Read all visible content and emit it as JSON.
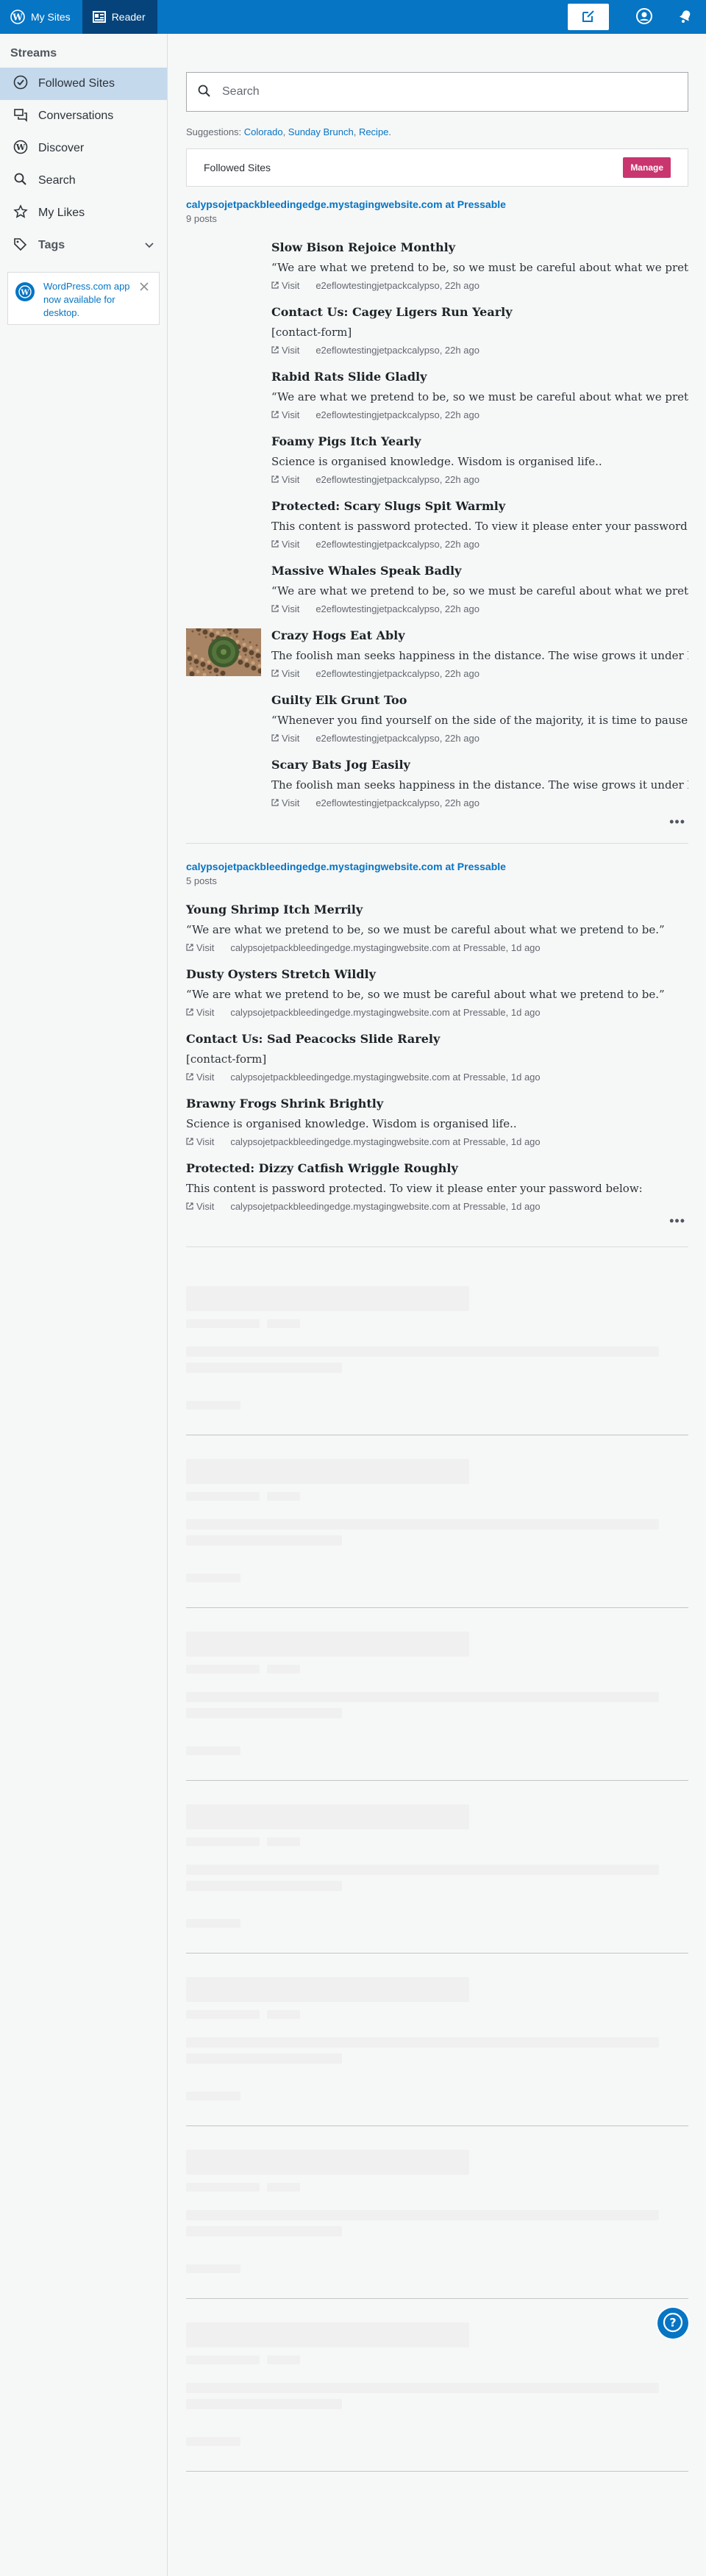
{
  "masterbar": {
    "my_sites": "My Sites",
    "reader": "Reader",
    "write_icon": "write-icon",
    "profile_icon": "profile-icon",
    "notifications_icon": "bell-icon"
  },
  "sidebar": {
    "heading": "Streams",
    "items": [
      {
        "label": "Followed Sites",
        "icon": "check-circle-icon"
      },
      {
        "label": "Conversations",
        "icon": "chat-icon"
      },
      {
        "label": "Discover",
        "icon": "wordpress-icon"
      },
      {
        "label": "Search",
        "icon": "search-icon"
      },
      {
        "label": "My Likes",
        "icon": "star-icon"
      },
      {
        "label": "Tags",
        "icon": "tag-icon"
      }
    ],
    "notice": "WordPress.com app now available for desktop."
  },
  "search": {
    "placeholder": "Search"
  },
  "suggestions": {
    "label": "Suggestions:",
    "items": [
      "Colorado",
      "Sunday Brunch",
      "Recipe"
    ]
  },
  "followed_card": {
    "title": "Followed Sites",
    "button": "Manage"
  },
  "groups": [
    {
      "site": "calypsojetpackbleedingedge.mystagingwebsite.com at Pressable",
      "count": "9 posts",
      "posts": [
        {
          "title": "Slow Bison Rejoice Monthly",
          "excerpt": "“We are what we pretend to be, so we must be careful about what we pretend to be.”",
          "visit": "Visit",
          "meta": "e2eflowtestingjetpackcalypso, 22h ago"
        },
        {
          "title": "Contact Us: Cagey Ligers Run Yearly",
          "excerpt": "[contact-form]",
          "visit": "Visit",
          "meta": "e2eflowtestingjetpackcalypso, 22h ago"
        },
        {
          "title": "Rabid Rats Slide Gladly",
          "excerpt": "“We are what we pretend to be, so we must be careful about what we pretend to be.”",
          "visit": "Visit",
          "meta": "e2eflowtestingjetpackcalypso, 22h ago"
        },
        {
          "title": "Foamy Pigs Itch Yearly",
          "excerpt": "Science is organised knowledge. Wisdom is organised life..",
          "visit": "Visit",
          "meta": "e2eflowtestingjetpackcalypso, 22h ago"
        },
        {
          "title": "Protected: Scary Slugs Spit Warmly",
          "excerpt": "This content is password protected. To view it please enter your password below:",
          "visit": "Visit",
          "meta": "e2eflowtestingjetpackcalypso, 22h ago"
        },
        {
          "title": "Massive Whales Speak Badly",
          "excerpt": "“We are what we pretend to be, so we must be careful about what we pretend to be.”",
          "visit": "Visit",
          "meta": "e2eflowtestingjetpackcalypso, 22h ago"
        },
        {
          "title": "Crazy Hogs Eat Ably",
          "excerpt": "The foolish man seeks happiness in the distance. The wise grows it under his feet.",
          "visit": "Visit",
          "meta": "e2eflowtestingjetpackcalypso, 22h ago",
          "thumb": true
        },
        {
          "title": "Guilty Elk Grunt Too",
          "excerpt": "“Whenever you find yourself on the side of the majority, it is time to pause and reflect.”",
          "visit": "Visit",
          "meta": "e2eflowtestingjetpackcalypso, 22h ago"
        },
        {
          "title": "Scary Bats Jog Easily",
          "excerpt": "The foolish man seeks happiness in the distance. The wise grows it under his feet.",
          "visit": "Visit",
          "meta": "e2eflowtestingjetpackcalypso, 22h ago"
        }
      ]
    },
    {
      "site": "calypsojetpackbleedingedge.mystagingwebsite.com at Pressable",
      "count": "5 posts",
      "posts": [
        {
          "title": "Young Shrimp Itch Merrily",
          "excerpt": "“We are what we pretend to be, so we must be careful about what we pretend to be.”",
          "visit": "Visit",
          "meta": "calypsojetpackbleedingedge.mystagingwebsite.com at Pressable, 1d ago"
        },
        {
          "title": "Dusty Oysters Stretch Wildly",
          "excerpt": "“We are what we pretend to be, so we must be careful about what we pretend to be.”",
          "visit": "Visit",
          "meta": "calypsojetpackbleedingedge.mystagingwebsite.com at Pressable, 1d ago"
        },
        {
          "title": "Contact Us: Sad Peacocks Slide Rarely",
          "excerpt": "[contact-form]",
          "visit": "Visit",
          "meta": "calypsojetpackbleedingedge.mystagingwebsite.com at Pressable, 1d ago"
        },
        {
          "title": "Brawny Frogs Shrink Brightly",
          "excerpt": "Science is organised knowledge. Wisdom is organised life..",
          "visit": "Visit",
          "meta": "calypsojetpackbleedingedge.mystagingwebsite.com at Pressable, 1d ago"
        },
        {
          "title": "Protected: Dizzy Catfish Wriggle Roughly",
          "excerpt": "This content is password protected. To view it please enter your password below:",
          "visit": "Visit",
          "meta": "calypsojetpackbleedingedge.mystagingwebsite.com at Pressable, 1d ago"
        }
      ]
    }
  ],
  "more_icon": "ellipsis-icon",
  "help_icon": "help-icon",
  "colors": {
    "masterbar": "#0675c4",
    "masterbar_active": "#06437a",
    "accent": "#0675c4",
    "manage": "#c9356e",
    "selected": "#c5d9ed"
  }
}
